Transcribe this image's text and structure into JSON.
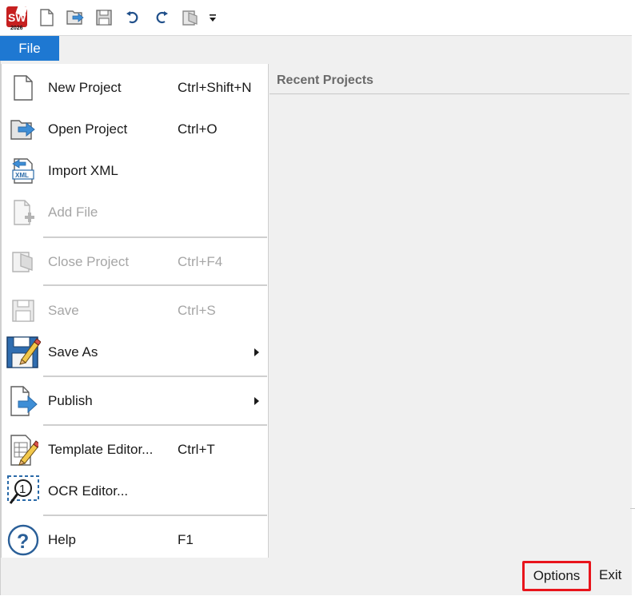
{
  "app": {
    "logo_text": "SW",
    "logo_year": "2026",
    "brand_color": "#d12a2a"
  },
  "toolbar": {
    "buttons": [
      {
        "name": "new-icon"
      },
      {
        "name": "open-icon"
      },
      {
        "name": "save-icon"
      },
      {
        "name": "undo-icon"
      },
      {
        "name": "redo-icon"
      },
      {
        "name": "close-project-icon"
      },
      {
        "name": "customize-dropdown-icon"
      }
    ]
  },
  "tabs": {
    "file_label": "File",
    "active_color": "#1e78d2"
  },
  "menu": {
    "new_project": {
      "label": "New Project",
      "shortcut": "Ctrl+Shift+N"
    },
    "open_project": {
      "label": "Open Project",
      "shortcut": "Ctrl+O"
    },
    "import_xml": {
      "label": "Import XML",
      "icon_text": "XML"
    },
    "add_file": {
      "label": "Add File"
    },
    "close_project": {
      "label": "Close Project",
      "shortcut": "Ctrl+F4"
    },
    "save": {
      "label": "Save",
      "shortcut": "Ctrl+S"
    },
    "save_as": {
      "label": "Save As"
    },
    "publish": {
      "label": "Publish"
    },
    "template_editor": {
      "label": "Template Editor...",
      "shortcut": "Ctrl+T"
    },
    "ocr_editor": {
      "label": "OCR Editor...",
      "icon_text": "1"
    },
    "help": {
      "label": "Help",
      "shortcut": "F1",
      "icon_text": "?"
    }
  },
  "recent": {
    "title": "Recent Projects"
  },
  "bottom": {
    "options_label": "Options",
    "exit_label": "Exit",
    "highlight_color": "#e8141b"
  }
}
